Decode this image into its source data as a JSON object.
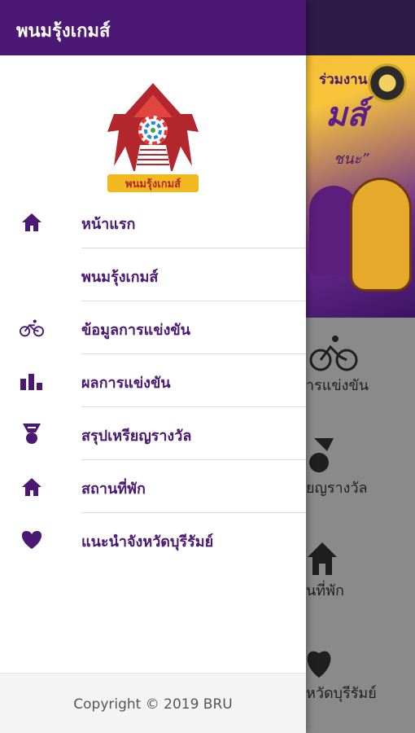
{
  "app": {
    "title": "พนมรุ้งเกมส์"
  },
  "background": {
    "banner_line1": "ร่วมงาน",
    "banner_big": "มส์",
    "banner_sub": "ชนะ”",
    "tiles": [
      {
        "label": "ารแข่งขัน",
        "icon": "bicycle-icon"
      },
      {
        "label": "ยญรางวัล",
        "icon": "medal-icon"
      },
      {
        "label": "นที่พัก",
        "icon": "home-icon"
      },
      {
        "label": "หวัดบุรีรัมย์",
        "icon": "heart-icon"
      }
    ]
  },
  "drawer": {
    "logo_text": "พนมรุ้งเกมส์",
    "items": [
      {
        "label": "หน้าแรก",
        "icon": "home-icon"
      },
      {
        "label": "พนมรุ้งเกมส์",
        "icon": ""
      },
      {
        "label": "ข้อมูลการแข่งขัน",
        "icon": "bicycle-icon"
      },
      {
        "label": "ผลการแข่งขัน",
        "icon": "bar-chart-icon"
      },
      {
        "label": "สรุปเหรียญรางวัล",
        "icon": "medal-icon"
      },
      {
        "label": "สถานที่พัก",
        "icon": "home-icon"
      },
      {
        "label": "แนะนำจังหวัดบุรีรัมย์",
        "icon": "heart-icon"
      }
    ],
    "footer": "Copyright © 2019 BRU"
  },
  "colors": {
    "primary": "#4b1874",
    "dark_primary": "#2e1a47",
    "scrim": "#8a8a8a"
  }
}
